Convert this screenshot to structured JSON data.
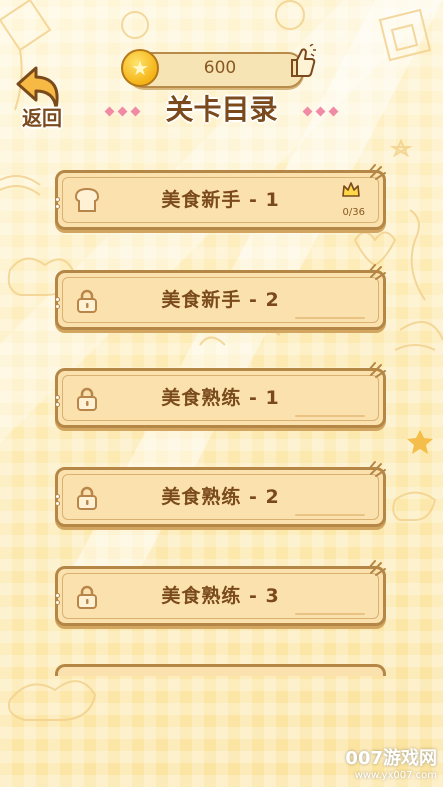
{
  "header": {
    "coin_value": "600",
    "back_label": "返回",
    "title": "关卡目录"
  },
  "levels": [
    {
      "label": "美食新手 - 1",
      "locked": false,
      "progress": "0/36"
    },
    {
      "label": "美食新手 - 2",
      "locked": true
    },
    {
      "label": "美食熟练 - 1",
      "locked": true
    },
    {
      "label": "美食熟练 - 2",
      "locked": true
    },
    {
      "label": "美食熟练 - 3",
      "locked": true
    }
  ],
  "watermark": {
    "line1": "007游戏网",
    "line2": "www.yx007.com"
  },
  "colors": {
    "accent": "#7a4a1c",
    "panel": "#fbe1ad",
    "border": "#b58747",
    "background": "#fdf0c8"
  }
}
